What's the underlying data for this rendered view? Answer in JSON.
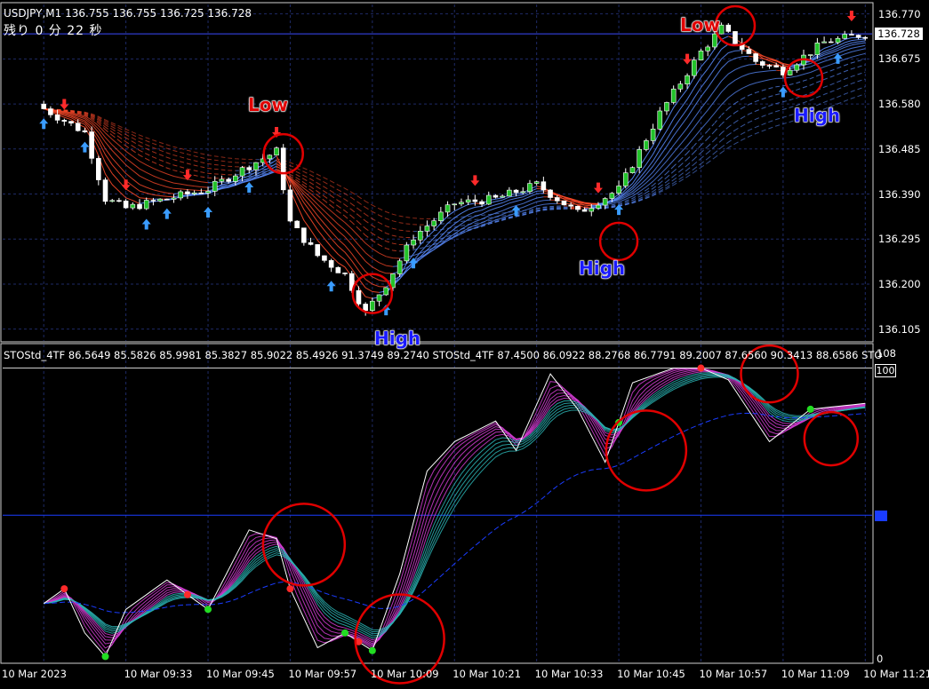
{
  "header": {
    "symbol_line": "USDJPY,M1  136.755 136.755 136.725 136.728",
    "countdown": "残り 0 分 22 秒"
  },
  "indicator": {
    "label": "STOStd_4TF 86.5649 85.5826 85.9981 85.3827 85.9022 85.4926 91.3749 89.2740   STOStd_4TF 87.4500 86.0922 88.2768 86.7791 89.2007 87.6560 90.3413 88.6586   STO"
  },
  "price_axis": {
    "ticks": [
      "136.770",
      "136.675",
      "136.580",
      "136.485",
      "136.390",
      "136.295",
      "136.200",
      "136.105"
    ],
    "current": "136.728"
  },
  "indicator_axis": {
    "top_label": "108",
    "hundred": "100",
    "bottom_label": "0"
  },
  "time_axis": [
    "10 Mar 2023",
    "10 Mar 09:33",
    "10 Mar 09:45",
    "10 Mar 09:57",
    "10 Mar 10:09",
    "10 Mar 10:21",
    "10 Mar 10:33",
    "10 Mar 10:45",
    "10 Mar 10:57",
    "10 Mar 11:09",
    "10 Mar 11:21"
  ],
  "annotations": [
    {
      "text": "Low",
      "kind": "low"
    },
    {
      "text": "Low",
      "kind": "low"
    },
    {
      "text": "High",
      "kind": "high"
    },
    {
      "text": "High",
      "kind": "high"
    },
    {
      "text": "High",
      "kind": "high"
    }
  ],
  "colors": {
    "background": "#000000",
    "grid": "#1e2a66",
    "bull_candle": "#22c22a",
    "bear_candle": "#ffffff",
    "ribbon_bear": "#ff4a2a",
    "ribbon_bull": "#5a8cff",
    "arrow_up": "#3a9cff",
    "arrow_down": "#ff2a2a",
    "circle": "#e00000",
    "stoch_main": "#ffffff",
    "stoch_ribbon_a": "#d23cd2",
    "stoch_ribbon_b": "#2ab4b4",
    "stoch_mid_line": "#1a3cff"
  },
  "chart_data": {
    "type": "candlestick",
    "symbol": "USDJPY",
    "timeframe": "M1",
    "price_ylim": [
      136.08,
      136.79
    ],
    "current_price": 136.728,
    "close_path": [
      {
        "t": "09:21",
        "close": 136.57
      },
      {
        "t": "09:27",
        "close": 136.52
      },
      {
        "t": "09:30",
        "close": 136.38
      },
      {
        "t": "09:33",
        "close": 136.36
      },
      {
        "t": "09:39",
        "close": 136.38
      },
      {
        "t": "09:45",
        "close": 136.4
      },
      {
        "t": "09:51",
        "close": 136.45
      },
      {
        "t": "09:55",
        "close": 136.48
      },
      {
        "t": "09:57",
        "close": 136.33
      },
      {
        "t": "10:01",
        "close": 136.26
      },
      {
        "t": "10:05",
        "close": 136.22
      },
      {
        "t": "10:08",
        "close": 136.14
      },
      {
        "t": "10:11",
        "close": 136.2
      },
      {
        "t": "10:15",
        "close": 136.3
      },
      {
        "t": "10:21",
        "close": 136.37
      },
      {
        "t": "10:27",
        "close": 136.38
      },
      {
        "t": "10:33",
        "close": 136.41
      },
      {
        "t": "10:39",
        "close": 136.35
      },
      {
        "t": "10:45",
        "close": 136.4
      },
      {
        "t": "10:51",
        "close": 136.56
      },
      {
        "t": "10:57",
        "close": 136.69
      },
      {
        "t": "11:00",
        "close": 136.74
      },
      {
        "t": "11:05",
        "close": 136.67
      },
      {
        "t": "11:09",
        "close": 136.65
      },
      {
        "t": "11:15",
        "close": 136.71
      },
      {
        "t": "11:21",
        "close": 136.728
      }
    ],
    "stochastic": {
      "ylim": [
        0,
        108
      ],
      "level_100": 100,
      "series_main": [
        {
          "t": "09:21",
          "v": 20
        },
        {
          "t": "09:24",
          "v": 25
        },
        {
          "t": "09:27",
          "v": 10
        },
        {
          "t": "09:30",
          "v": 2
        },
        {
          "t": "09:33",
          "v": 18
        },
        {
          "t": "09:39",
          "v": 28
        },
        {
          "t": "09:45",
          "v": 18
        },
        {
          "t": "09:51",
          "v": 45
        },
        {
          "t": "09:55",
          "v": 42
        },
        {
          "t": "09:57",
          "v": 25
        },
        {
          "t": "10:01",
          "v": 5
        },
        {
          "t": "10:05",
          "v": 10
        },
        {
          "t": "10:09",
          "v": 4
        },
        {
          "t": "10:13",
          "v": 30
        },
        {
          "t": "10:17",
          "v": 65
        },
        {
          "t": "10:21",
          "v": 75
        },
        {
          "t": "10:27",
          "v": 82
        },
        {
          "t": "10:30",
          "v": 72
        },
        {
          "t": "10:35",
          "v": 98
        },
        {
          "t": "10:39",
          "v": 86
        },
        {
          "t": "10:43",
          "v": 68
        },
        {
          "t": "10:47",
          "v": 95
        },
        {
          "t": "10:53",
          "v": 100
        },
        {
          "t": "10:57",
          "v": 100
        },
        {
          "t": "11:01",
          "v": 96
        },
        {
          "t": "11:07",
          "v": 75
        },
        {
          "t": "11:13",
          "v": 86
        },
        {
          "t": "11:21",
          "v": 88
        }
      ]
    }
  }
}
